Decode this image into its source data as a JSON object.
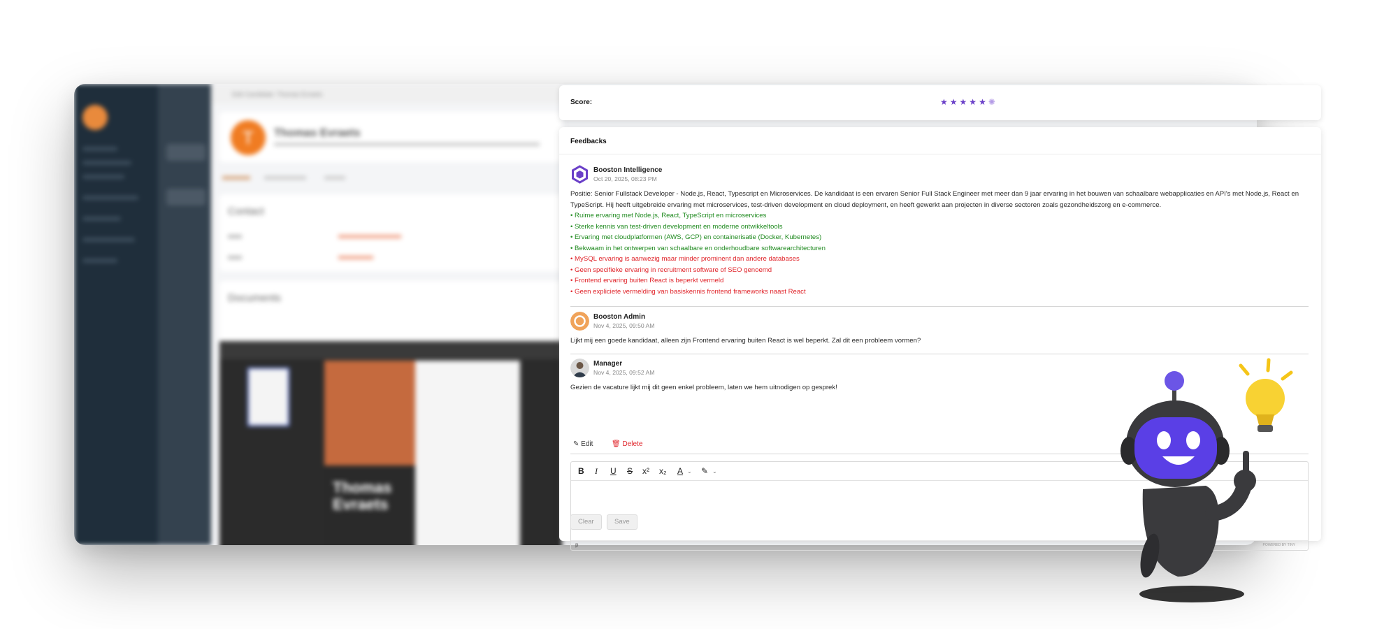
{
  "background": {
    "header": "Edit Candidate: Thomas Evraets",
    "candidate_name": "Thomas Evraets",
    "avatar_initial": "T",
    "contact_heading": "Contact",
    "documents_heading": "Documents",
    "cv_name_line1": "Thomas",
    "cv_name_line2": "Evraets"
  },
  "score": {
    "label": "Score:",
    "stars_filled": 5,
    "stars_total": 6
  },
  "feedbacks": {
    "title": "Feedbacks",
    "entries": [
      {
        "author": "Booston Intelligence",
        "date": "Oct 20, 2025, 08:23 PM",
        "text": "Positie: Senior Fullstack Developer - Node.js, React, Typescript en Microservices. De kandidaat is een ervaren Senior Full Stack Engineer met meer dan 9 jaar ervaring in het bouwen van schaalbare webapplicaties en API's met Node.js, React en TypeScript. Hij heeft uitgebreide ervaring met microservices, test-driven development en cloud deployment, en heeft gewerkt aan projecten in diverse sectoren zoals gezondheidszorg en e-commerce.",
        "positives": [
          "• Ruime ervaring met Node.js, React, TypeScript en microservices",
          "• Sterke kennis van test-driven development en moderne ontwikkeltools",
          "• Ervaring met cloudplatformen (AWS, GCP) en containerisatie (Docker, Kubernetes)",
          "• Bekwaam in het ontwerpen van schaalbare en onderhoudbare softwarearchitecturen"
        ],
        "negatives": [
          "• MySQL ervaring is aanwezig maar minder prominent dan andere databases",
          "• Geen specifieke ervaring in recruitment software of SEO genoemd",
          "• Frontend ervaring buiten React is beperkt vermeld",
          "• Geen expliciete vermelding van basiskennis frontend frameworks naast React"
        ]
      },
      {
        "author": "Booston Admin",
        "date": "Nov 4, 2025, 09:50 AM",
        "text": "Lijkt mij een goede kandidaat, alleen zijn Frontend ervaring buiten React is wel beperkt. Zal dit een probleem vormen?"
      },
      {
        "author": "Manager",
        "date": "Nov 4, 2025, 09:52 AM",
        "text": "Gezien de vacature lijkt mij dit geen enkel probleem, laten we hem uitnodigen op gesprek!"
      }
    ],
    "actions": {
      "edit": "Edit",
      "delete": "Delete"
    },
    "editor": {
      "status_tag": "p",
      "powered_by": "POWERED BY TINY"
    },
    "buttons": {
      "clear": "Clear",
      "save": "Save"
    }
  },
  "colors": {
    "accent": "#6a3fc8",
    "positive": "#1f8a1f",
    "negative": "#e0242a",
    "brand_orange": "#f07c22"
  }
}
